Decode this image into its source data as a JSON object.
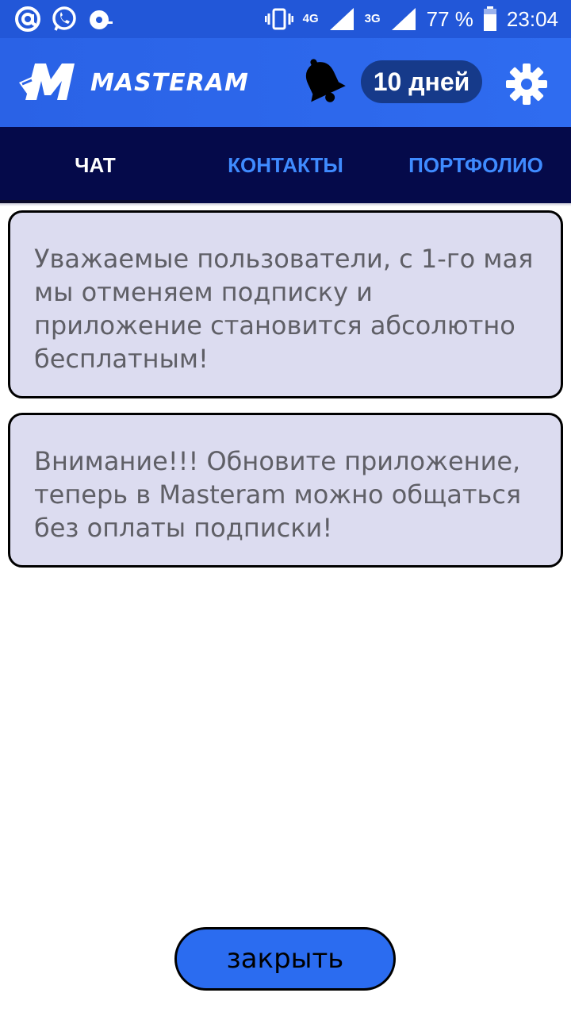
{
  "status_bar": {
    "battery_percent": "77 %",
    "time": "23:04",
    "network_1": "4G",
    "network_2": "3G",
    "icons": [
      "at-sign-icon",
      "whatsapp-icon",
      "media-icon",
      "vibrate-icon",
      "signal-icon",
      "battery-icon"
    ]
  },
  "header": {
    "brand": "MASTERAM",
    "subscription_days": "10 дней",
    "accent": "#2f6cf0",
    "icons": [
      "bell-icon",
      "gear-icon"
    ]
  },
  "tabs": [
    {
      "label": "ЧАТ",
      "active": true
    },
    {
      "label": "КОНТАКТЫ",
      "active": false
    },
    {
      "label": "ПОРТФОЛИО",
      "active": false
    }
  ],
  "messages": [
    {
      "text": "Уважаемые пользователи, с 1-го мая мы отменяем подписку и приложение становится абсолютно бесплатным!"
    },
    {
      "text": "Внимание!!! Обновите приложение, теперь в Masteram можно общаться без оплаты подписки!"
    }
  ],
  "close_button": {
    "label": "закрыть"
  },
  "colors": {
    "tab_bar": "#050a4a",
    "tab_active": "#ffffff",
    "tab_inactive": "#3f8bff",
    "message_bg": "#dcdcf0"
  }
}
